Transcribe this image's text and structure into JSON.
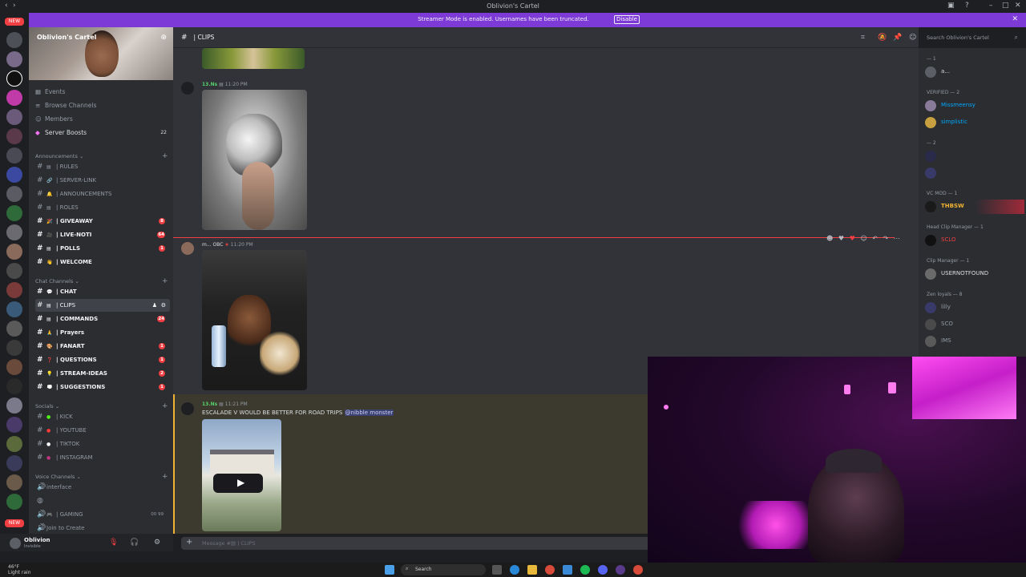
{
  "window": {
    "title": "Oblivion's Cartel"
  },
  "streamer_bar": {
    "message": "Streamer Mode is enabled. Usernames have been truncated.",
    "button": "Disable",
    "close": "✕"
  },
  "guild_badges": {
    "top": "NEW",
    "bottom": "NEW"
  },
  "server": {
    "name": "Oblivion's Cartel",
    "nav": [
      {
        "label": "Events",
        "icon": "calendar-icon"
      },
      {
        "label": "Browse Channels",
        "icon": "browse-icon"
      },
      {
        "label": "Members",
        "icon": "members-icon"
      },
      {
        "label": "Server Boosts",
        "icon": "boost-icon",
        "count": "22"
      }
    ],
    "categories": {
      "announcements": "Announcements",
      "chat": "Chat Channels",
      "socials": "Socials",
      "voice": "Voice Channels"
    },
    "channels": [
      {
        "label": "| RULES",
        "emoji": "▤",
        "count": ""
      },
      {
        "label": "| SERVER-LINK",
        "emoji": "🔗",
        "count": ""
      },
      {
        "label": "| ANNOUNCEMENTS",
        "emoji": "🔔",
        "count": ""
      },
      {
        "label": "| ROLES",
        "emoji": "▤",
        "count": ""
      },
      {
        "label": "| GIVEAWAY",
        "emoji": "🎉",
        "count": "8"
      },
      {
        "label": "| LIVE-NOTI",
        "emoji": "🎥",
        "count": "64"
      },
      {
        "label": "| POLLS",
        "emoji": "▤",
        "count": "1"
      },
      {
        "label": "| WELCOME",
        "emoji": "👋",
        "count": ""
      },
      {
        "label": "| CHAT",
        "emoji": "💬",
        "count": ""
      },
      {
        "label": "| CLIPS",
        "emoji": "▤",
        "count": ""
      },
      {
        "label": "| COMMANDS",
        "emoji": "▤",
        "count": "24"
      },
      {
        "label": "| Prayers",
        "emoji": "🙏",
        "count": ""
      },
      {
        "label": "| FANART",
        "emoji": "🎨",
        "count": "1"
      },
      {
        "label": "| QUESTIONS",
        "emoji": "❓",
        "count": "1"
      },
      {
        "label": "| STREAM-IDEAS",
        "emoji": "💡",
        "count": "2"
      },
      {
        "label": "| SUGGESTIONS",
        "emoji": "💭",
        "count": "1"
      },
      {
        "label": "| KICK",
        "emoji": "●",
        "count": ""
      },
      {
        "label": "| YOUTUBE",
        "emoji": "●",
        "count": ""
      },
      {
        "label": "| TIKTOK",
        "emoji": "●",
        "count": ""
      },
      {
        "label": "| INSTAGRAM",
        "emoji": "●",
        "count": ""
      }
    ],
    "voice": [
      {
        "label": "interface"
      },
      {
        "label": "| GAMING",
        "extra": "00  99"
      },
      {
        "label": "Join to Create"
      }
    ]
  },
  "user": {
    "name": "Oblivion",
    "status": "Invisible"
  },
  "header": {
    "channel": "| CLIPS",
    "search_placeholder": "Search Oblivion's Cartel"
  },
  "messages": [
    {
      "author": "13.Ns",
      "time": "11:20 PM"
    },
    {
      "author": "m...",
      "tag": "OBC",
      "time": "11:20 PM"
    },
    {
      "author": "13.Ns",
      "time": "11:21 PM",
      "text": "ESCALADE V WOULD BE BETTER FOR ROAD TRIPS",
      "mention": "@nibble monster"
    }
  ],
  "composer": {
    "placeholder": "Message #▤ | CLIPS"
  },
  "members": {
    "groups": [
      {
        "label": "— 1"
      },
      {
        "label": "VERIFIED — 2"
      },
      {
        "label": "— 2"
      },
      {
        "label": "VC MOD — 1"
      },
      {
        "label": "Head Clip Manager — 1"
      },
      {
        "label": "Clip Manager — 1"
      },
      {
        "label": "Zen loyals — 8"
      }
    ],
    "names": [
      {
        "name": "a...",
        "color": "#dbdee1"
      },
      {
        "name": "Missmeensy",
        "color": "#00a8fc"
      },
      {
        "name": "simplistic",
        "color": "#00a8fc"
      },
      {
        "name": "THBSW",
        "color": "#f0b232"
      },
      {
        "name": "SCLO",
        "color": "#f23f43"
      },
      {
        "name": "USERNOTFOUND",
        "color": "#dbdee1"
      },
      {
        "name": "lilly",
        "color": "#949ba4"
      },
      {
        "name": "SCO",
        "color": "#949ba4"
      },
      {
        "name": "IMS",
        "color": "#949ba4"
      }
    ]
  },
  "taskbar": {
    "weather_temp": "46°F",
    "weather_desc": "Light rain",
    "search": "Search"
  }
}
